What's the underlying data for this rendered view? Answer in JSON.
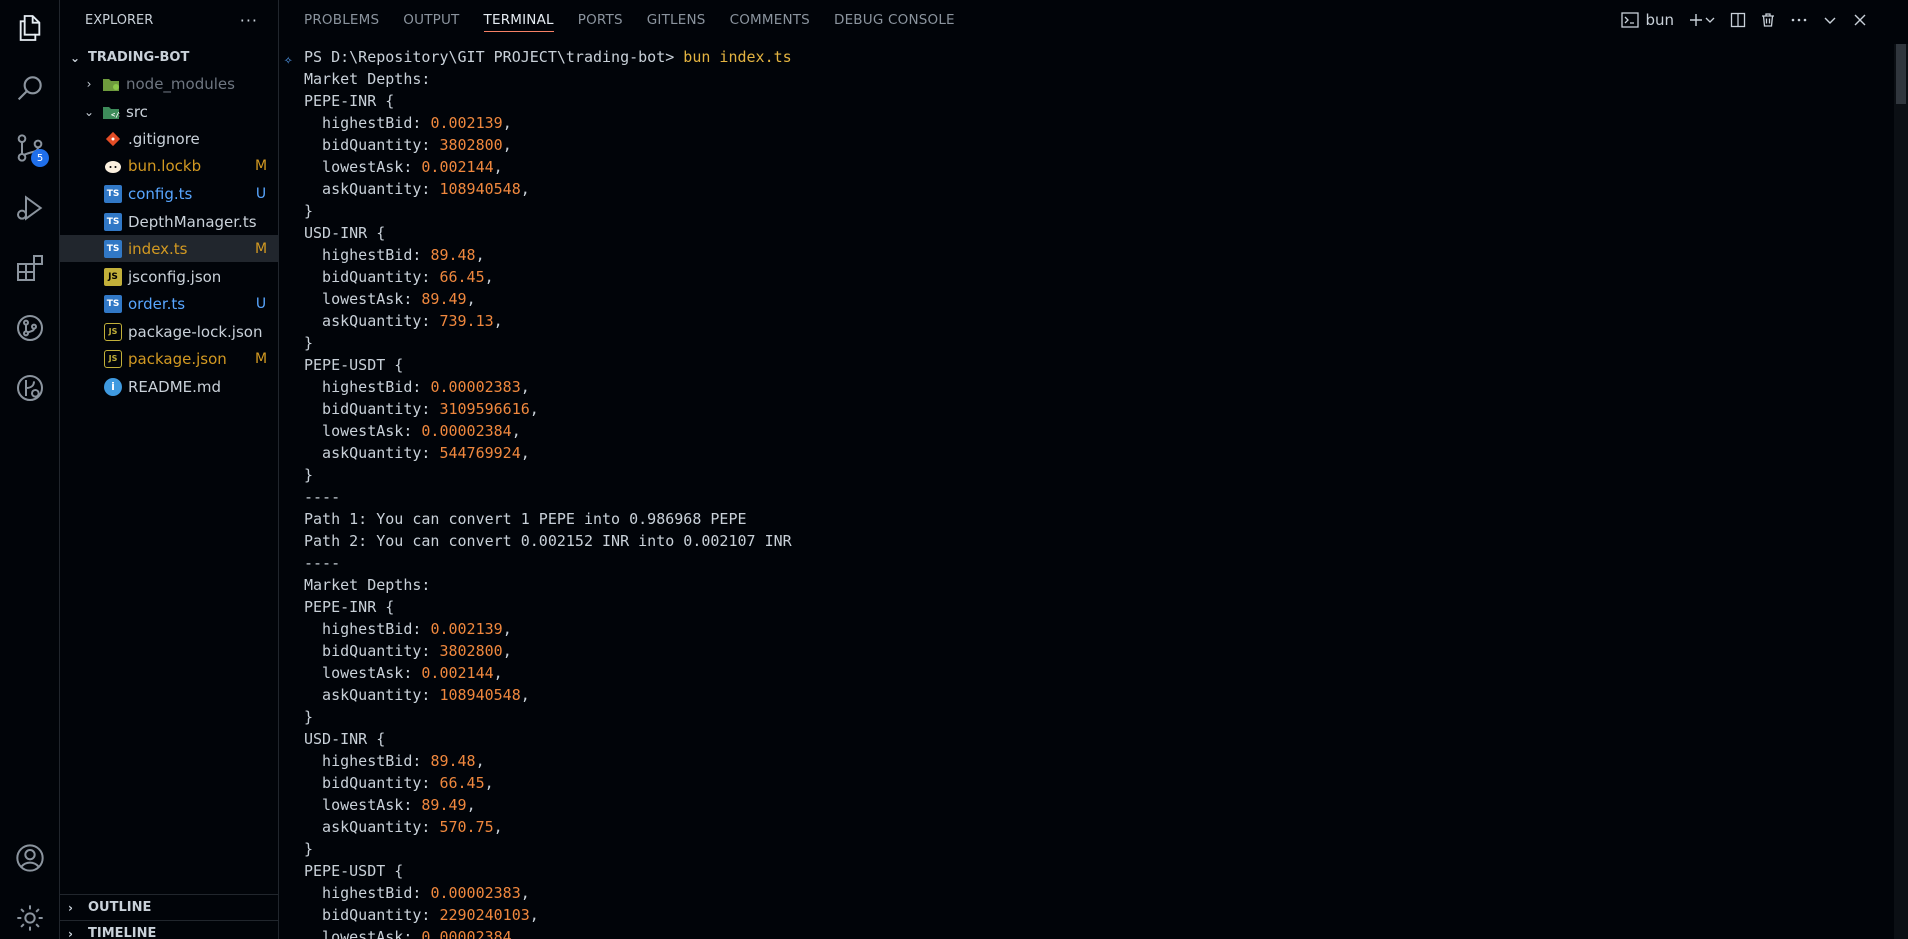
{
  "sidebar": {
    "title": "EXPLORER",
    "more": "···",
    "root": "TRADING-BOT",
    "items": [
      {
        "name": "node_modules",
        "type": "folder",
        "status": ""
      },
      {
        "name": "src",
        "type": "folder-open",
        "status": ""
      },
      {
        "name": ".gitignore",
        "type": "git",
        "status": ""
      },
      {
        "name": "bun.lockb",
        "type": "bun",
        "status": "M"
      },
      {
        "name": "config.ts",
        "type": "ts",
        "status": "U"
      },
      {
        "name": "DepthManager.ts",
        "type": "ts",
        "status": ""
      },
      {
        "name": "index.ts",
        "type": "ts",
        "status": "M"
      },
      {
        "name": "jsconfig.json",
        "type": "js",
        "status": ""
      },
      {
        "name": "order.ts",
        "type": "ts",
        "status": "U"
      },
      {
        "name": "package-lock.json",
        "type": "json",
        "status": ""
      },
      {
        "name": "package.json",
        "type": "json",
        "status": "M"
      },
      {
        "name": "README.md",
        "type": "info",
        "status": ""
      }
    ],
    "outline": "OUTLINE",
    "timeline": "TIMELINE"
  },
  "activity": {
    "scm_badge": "5"
  },
  "panel": {
    "tabs": [
      "PROBLEMS",
      "OUTPUT",
      "TERMINAL",
      "PORTS",
      "GITLENS",
      "COMMENTS",
      "DEBUG CONSOLE"
    ],
    "active_tab": "TERMINAL",
    "terminal_name": "bun"
  },
  "terminal": {
    "prompt": "PS D:\\Repository\\GIT PROJECT\\trading-bot> ",
    "command": "bun index.ts",
    "lines": [
      {
        "t": "Market Depths:"
      },
      {
        "t": "PEPE-INR {"
      },
      {
        "k": "  highestBid: ",
        "v": "0.002139",
        "e": ","
      },
      {
        "k": "  bidQuantity: ",
        "v": "3802800",
        "e": ","
      },
      {
        "k": "  lowestAsk: ",
        "v": "0.002144",
        "e": ","
      },
      {
        "k": "  askQuantity: ",
        "v": "108940548",
        "e": ","
      },
      {
        "t": "}"
      },
      {
        "t": "USD-INR {"
      },
      {
        "k": "  highestBid: ",
        "v": "89.48",
        "e": ","
      },
      {
        "k": "  bidQuantity: ",
        "v": "66.45",
        "e": ","
      },
      {
        "k": "  lowestAsk: ",
        "v": "89.49",
        "e": ","
      },
      {
        "k": "  askQuantity: ",
        "v": "739.13",
        "e": ","
      },
      {
        "t": "}"
      },
      {
        "t": "PEPE-USDT {"
      },
      {
        "k": "  highestBid: ",
        "v": "0.00002383",
        "e": ","
      },
      {
        "k": "  bidQuantity: ",
        "v": "3109596616",
        "e": ","
      },
      {
        "k": "  lowestAsk: ",
        "v": "0.00002384",
        "e": ","
      },
      {
        "k": "  askQuantity: ",
        "v": "544769924",
        "e": ","
      },
      {
        "t": "}"
      },
      {
        "t": "----"
      },
      {
        "t": "Path 1: You can convert 1 PEPE into 0.986968 PEPE"
      },
      {
        "t": "Path 2: You can convert 0.002152 INR into 0.002107 INR"
      },
      {
        "t": "----"
      },
      {
        "t": "Market Depths:"
      },
      {
        "t": "PEPE-INR {"
      },
      {
        "k": "  highestBid: ",
        "v": "0.002139",
        "e": ","
      },
      {
        "k": "  bidQuantity: ",
        "v": "3802800",
        "e": ","
      },
      {
        "k": "  lowestAsk: ",
        "v": "0.002144",
        "e": ","
      },
      {
        "k": "  askQuantity: ",
        "v": "108940548",
        "e": ","
      },
      {
        "t": "}"
      },
      {
        "t": "USD-INR {"
      },
      {
        "k": "  highestBid: ",
        "v": "89.48",
        "e": ","
      },
      {
        "k": "  bidQuantity: ",
        "v": "66.45",
        "e": ","
      },
      {
        "k": "  lowestAsk: ",
        "v": "89.49",
        "e": ","
      },
      {
        "k": "  askQuantity: ",
        "v": "570.75",
        "e": ","
      },
      {
        "t": "}"
      },
      {
        "t": "PEPE-USDT {"
      },
      {
        "k": "  highestBid: ",
        "v": "0.00002383",
        "e": ","
      },
      {
        "k": "  bidQuantity: ",
        "v": "2290240103",
        "e": ","
      },
      {
        "k": "  lowestAsk: ",
        "v": "0.00002384",
        "e": ","
      }
    ]
  }
}
